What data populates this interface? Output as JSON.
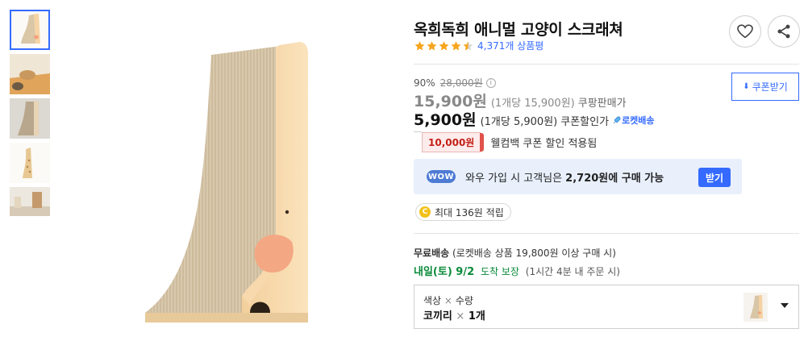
{
  "product": {
    "title": "옥희독희 애니멀 고양이 스크래쳐",
    "rating": 4.5,
    "review_count": "4,371개 상품평"
  },
  "thumbnails": [
    {
      "name": "elephant-scratcher-front",
      "active": true
    },
    {
      "name": "cat-on-scratcher"
    },
    {
      "name": "scratcher-side-gray"
    },
    {
      "name": "giraffe-scratcher"
    },
    {
      "name": "room-scene"
    }
  ],
  "pricing": {
    "discount_rate": "90%",
    "original_price": "28,000원",
    "coupang_price": "15,900원",
    "coupang_unit": "(1개당 15,900원)",
    "coupang_label": "쿠팡판매가",
    "coupon_price": "5,900원",
    "coupon_unit": "(1개당 5,900원)",
    "coupon_label": "쿠폰할인가",
    "rocket_label": "로켓배송"
  },
  "coupon_button": {
    "label": "쿠폰받기"
  },
  "welcome": {
    "badge": "10,000원",
    "text": "웰컴백 쿠폰 할인 적용됨"
  },
  "wow": {
    "badge": "WOW",
    "text_prefix": "와우 가입 시 고객님은 ",
    "text_amount": "2,720원에 구매 가능",
    "button": "받기"
  },
  "cash": {
    "coin": "C",
    "text": "최대 136원 적립"
  },
  "shipping": {
    "free_label": "무료배송",
    "free_detail": "(로켓배송 상품 19,800원 이상 구매 시)",
    "arrival": "내일(토) 9/2",
    "arrival_label": "도착 보장",
    "arrival_note": "(1시간 4분 내 주문 시)"
  },
  "option": {
    "header_a": "색상",
    "header_x": "×",
    "header_b": "수량",
    "value_a": "코끼리",
    "value_x": "×",
    "value_b": "1개"
  },
  "colors": {
    "accent": "#346aff",
    "welcome_red": "#c31f17",
    "arrival_green": "#0a8a3a",
    "star": "#f6a51c"
  }
}
